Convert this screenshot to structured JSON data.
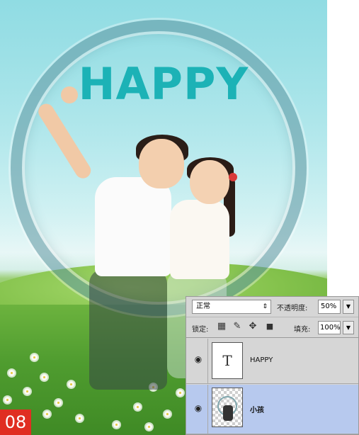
{
  "artwork": {
    "heading": "HAPPY",
    "step_badge": "08",
    "colors": {
      "heading": "#1cb2b6",
      "badge": "#e02e22",
      "selected_layer": "#b7c9ee"
    }
  },
  "layers_panel": {
    "blend_mode": "正常",
    "opacity_label": "不透明度:",
    "opacity_value": "50%",
    "lock_label": "锁定:",
    "lock_icons": [
      "lock-transparent-pixels-icon",
      "lock-image-pixels-icon",
      "lock-position-icon",
      "lock-all-icon"
    ],
    "fill_label": "填充:",
    "fill_value": "100%",
    "layers": [
      {
        "name": "HAPPY",
        "type": "text",
        "thumb_glyph": "T",
        "visible": true,
        "selected": false
      },
      {
        "name": "小孩",
        "type": "image",
        "visible": true,
        "selected": true
      }
    ]
  }
}
